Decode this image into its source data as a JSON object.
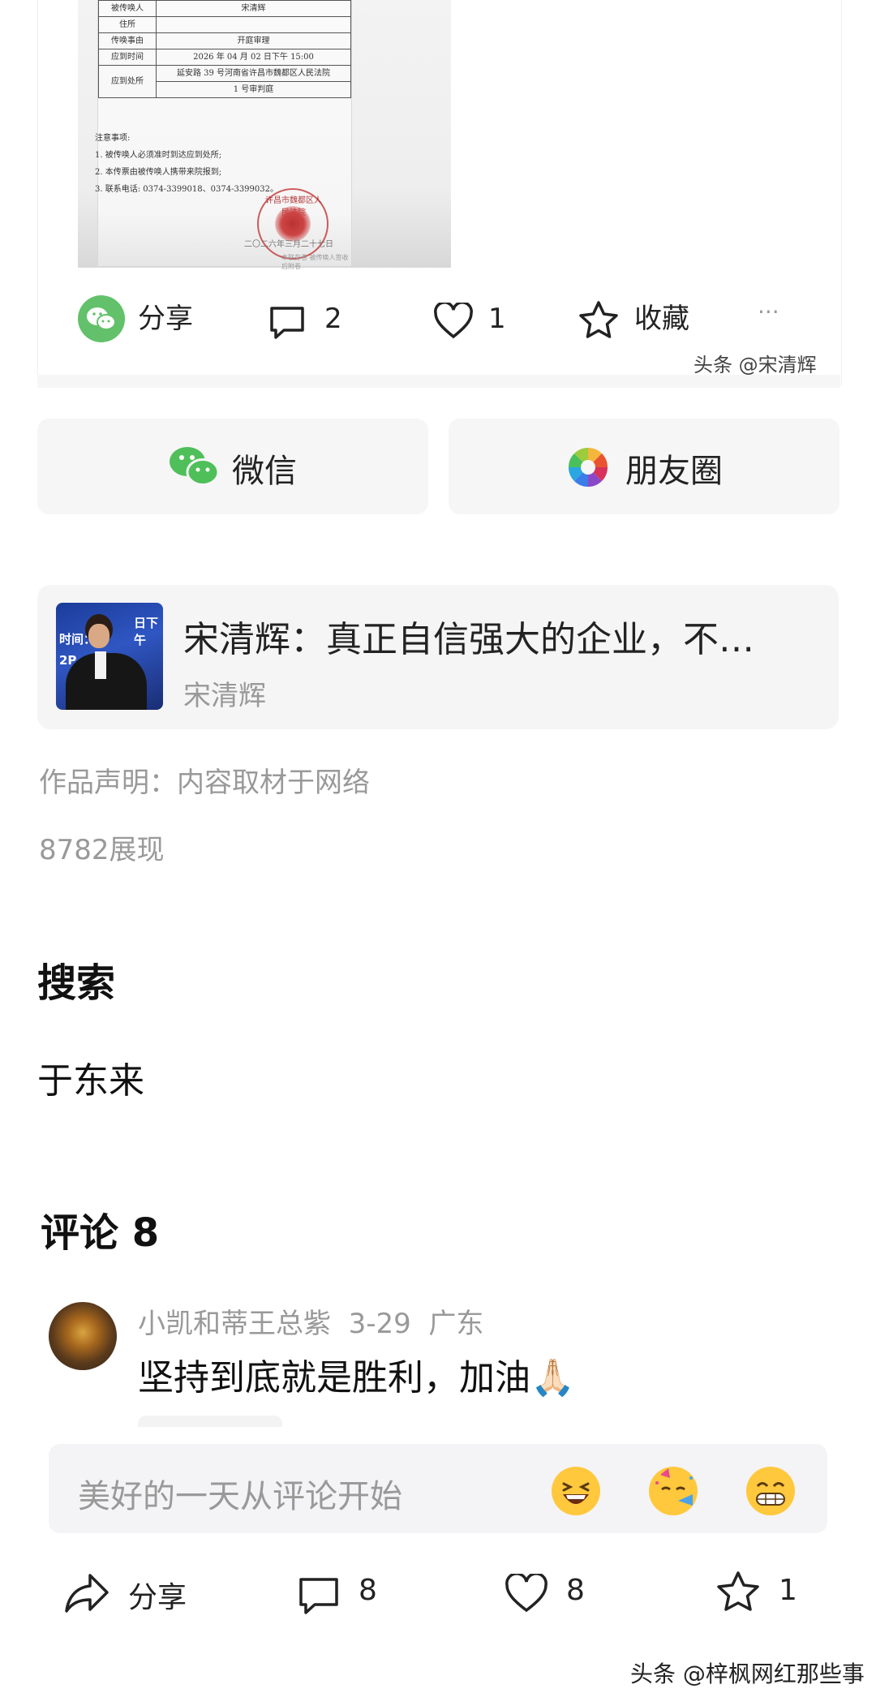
{
  "document": {
    "rows": [
      {
        "label": "被传唤人",
        "value": "宋清辉"
      },
      {
        "label": "住所",
        "value": ""
      },
      {
        "label": "传唤事由",
        "value": "开庭审理"
      },
      {
        "label": "应到时间",
        "value": "2026 年 04 月 02 日下午 15:00"
      },
      {
        "label": "应到处所",
        "value": "延安路 39 号河南省许昌市魏都区人民法院"
      },
      {
        "label": "",
        "value": "1 号审判庭"
      }
    ],
    "notes_title": "注意事项:",
    "notes": [
      "1. 被传唤人必须准时到达应到处所;",
      "2. 本传票由被传唤人携带来院报到;",
      "3. 联系电话: 0374-3399018、0374-3399032。"
    ],
    "stamp_text": "许昌市魏都区人民法院",
    "sign_date": "二〇二六年三月二十七日",
    "sign_note": "本联存卷 被传唤人签收后附卷"
  },
  "post_actions": {
    "share_label": "分享",
    "comment_count": "2",
    "like_count": "1",
    "collect_label": "收藏",
    "more": "···",
    "watermark": "头条 @宋清辉"
  },
  "share_buttons": {
    "wechat": "微信",
    "moments": "朋友圈"
  },
  "related": {
    "title": "宋清辉：真正自信强大的企业，不…",
    "author": "宋清辉",
    "thumb_text1": "时间：",
    "thumb_text2": "日下午",
    "thumb_text3": "2P"
  },
  "statement": "作品声明：内容取材于网络",
  "views": "8782展现",
  "search": {
    "heading": "搜索",
    "items": [
      "于东来"
    ]
  },
  "comments": {
    "heading": "评论 8",
    "items": [
      {
        "user": "小凯和蒂王总紫",
        "date": "3-29",
        "location": "广东",
        "text": "坚持到底就是胜利，加油🙏🏻"
      }
    ]
  },
  "input": {
    "placeholder": "美好的一天从评论开始",
    "emojis": [
      "grinning-squint-face",
      "partying-face",
      "beaming-face"
    ]
  },
  "bottom_bar": {
    "share_label": "分享",
    "comment_count": "8",
    "like_count": "8",
    "collect_count": "1"
  },
  "credit": "头条 @梓枫网红那些事",
  "colors": {
    "wechat_green": "#62c16a",
    "panel_bg": "#f6f6f6",
    "muted_text": "#999999"
  }
}
